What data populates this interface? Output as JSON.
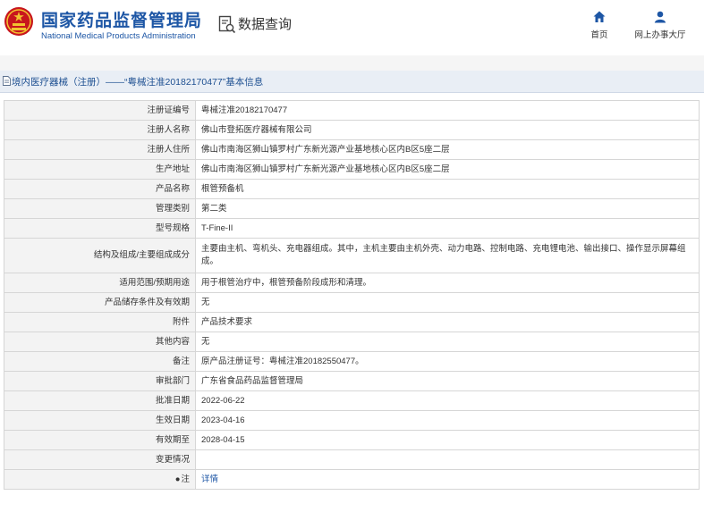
{
  "header": {
    "title_cn": "国家药品监督管理局",
    "title_en": "National Medical Products Administration",
    "query_label": "数据查询",
    "nav": {
      "home": "首页",
      "online_hall": "网上办事大厅"
    }
  },
  "breadcrumb": "境内医疗器械（注册）——“粤械注准20182170477”基本信息",
  "rows": [
    {
      "key": "注册证编号",
      "value": "粤械注准20182170477"
    },
    {
      "key": "注册人名称",
      "value": "佛山市登拓医疗器械有限公司"
    },
    {
      "key": "注册人住所",
      "value": "佛山市南海区狮山镇罗村广东新光源产业基地核心区内B区5座二层"
    },
    {
      "key": "生产地址",
      "value": "佛山市南海区狮山镇罗村广东新光源产业基地核心区内B区5座二层"
    },
    {
      "key": "产品名称",
      "value": "根管预备机"
    },
    {
      "key": "管理类别",
      "value": "第二类"
    },
    {
      "key": "型号规格",
      "value": "T-Fine-II"
    },
    {
      "key": "结构及组成/主要组成成分",
      "value": "主要由主机、弯机头、充电器组成。其中，主机主要由主机外壳、动力电路、控制电路、充电锂电池、输出接口、操作显示屏幕组成。"
    },
    {
      "key": "适用范围/预期用途",
      "value": "用于根管治疗中，根管预备阶段成形和清理。"
    },
    {
      "key": "产品储存条件及有效期",
      "value": "无"
    },
    {
      "key": "附件",
      "value": "产品技术要求"
    },
    {
      "key": "其他内容",
      "value": "无"
    },
    {
      "key": "备注",
      "value": "原产品注册证号：粤械注准20182550477。"
    },
    {
      "key": "审批部门",
      "value": "广东省食品药品监督管理局"
    },
    {
      "key": "批准日期",
      "value": "2022-06-22"
    },
    {
      "key": "生效日期",
      "value": "2023-04-16"
    },
    {
      "key": "有效期至",
      "value": "2028-04-15"
    },
    {
      "key": "变更情况",
      "value": ""
    }
  ],
  "note": {
    "key": "注",
    "link": "详情"
  },
  "colors": {
    "brand_blue": "#1d56a5",
    "emblem_red": "#c8161d",
    "emblem_gold": "#f2c230"
  }
}
